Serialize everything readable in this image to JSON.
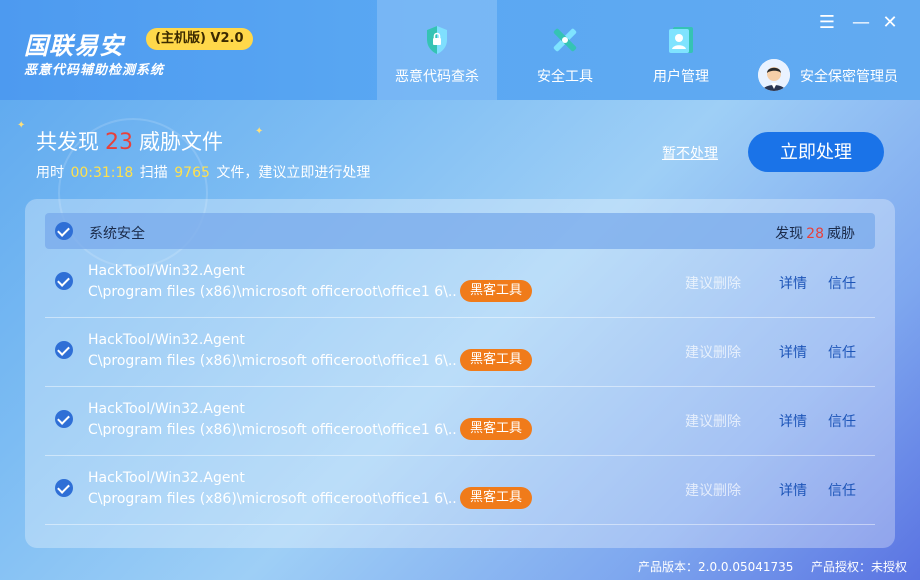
{
  "app": {
    "title": "国联易安",
    "edition_badge": "(主机版) V2.0",
    "subtitle": "恶意代码辅助检测系统"
  },
  "nav": {
    "tabs": [
      {
        "label": "恶意代码查杀",
        "icon": "shield-lock-icon",
        "active": true
      },
      {
        "label": "安全工具",
        "icon": "tools-icon",
        "active": false
      },
      {
        "label": "用户管理",
        "icon": "user-card-icon",
        "active": false
      }
    ],
    "user": {
      "name": "安全保密管理员",
      "avatar": "avatar-man-icon"
    }
  },
  "window_controls": {
    "menu": "☰",
    "minimize": "—",
    "close": "✕"
  },
  "summary": {
    "found_prefix": "共发现",
    "threat_count": "23",
    "found_suffix": "威胁文件",
    "time_prefix": "用时",
    "elapsed": "00:31:18",
    "scan_prefix": "扫描",
    "scanned": "9765",
    "scan_suffix": "文件，建议立即进行处理",
    "skip_label": "暂不处理",
    "process_label": "立即处理"
  },
  "group": {
    "label": "系统安全",
    "found_prefix": "发现",
    "count": "28",
    "found_suffix": "威胁"
  },
  "rows": [
    {
      "name": "HackTool/Win32.Agent",
      "path": "C\\program files (x86)\\microsoft officeroot\\office1 6\\..",
      "tag": "黑客工具",
      "suggest": "建议删除",
      "detail": "详情",
      "trust": "信任"
    },
    {
      "name": "HackTool/Win32.Agent",
      "path": "C\\program files (x86)\\microsoft officeroot\\office1 6\\..",
      "tag": "黑客工具",
      "suggest": "建议删除",
      "detail": "详情",
      "trust": "信任"
    },
    {
      "name": "HackTool/Win32.Agent",
      "path": "C\\program files (x86)\\microsoft officeroot\\office1 6\\..",
      "tag": "黑客工具",
      "suggest": "建议删除",
      "detail": "详情",
      "trust": "信任"
    },
    {
      "name": "HackTool/Win32.Agent",
      "path": "C\\program files (x86)\\microsoft officeroot\\office1 6\\..",
      "tag": "黑客工具",
      "suggest": "建议删除",
      "detail": "详情",
      "trust": "信任"
    }
  ],
  "footer": {
    "version": "产品版本：2.0.0.05041735",
    "license": "产品授权：未授权"
  },
  "colors": {
    "accent": "#1a73e8",
    "threat_red": "#e8403a",
    "tag_orange": "#f07b1a",
    "badge_yellow": "#ffd84a"
  }
}
